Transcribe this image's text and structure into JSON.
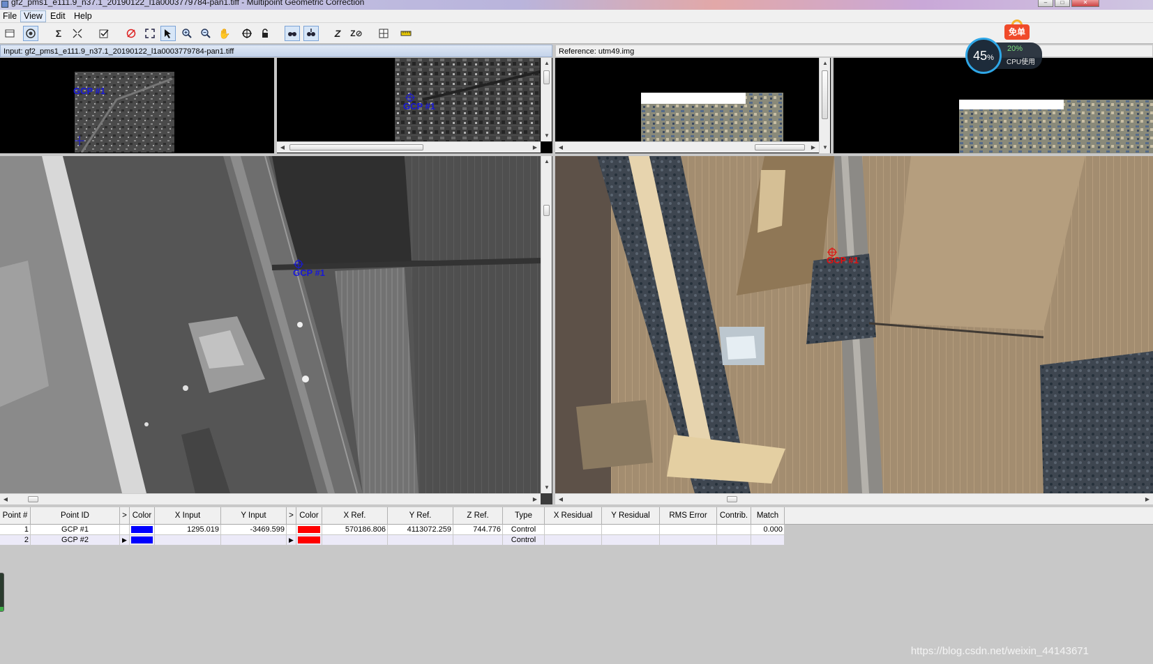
{
  "window": {
    "title": "gf2_pms1_e111.9_n37.1_20190122_l1a0003779784-pan1.tiff - Multipoint Geometric Correction"
  },
  "menu": [
    "File",
    "View",
    "Edit",
    "Help"
  ],
  "viewers": {
    "input_label": "Input: gf2_pms1_e111.9_n37.1_20190122_l1a0003779784-pan1.tiff",
    "reference_label": "Reference: utm49.img",
    "gcp_label": "GCP #1"
  },
  "gcp_table": {
    "columns": [
      "Point #",
      "Point ID",
      ">",
      "Color",
      "X Input",
      "Y Input",
      ">",
      "Color",
      "X Ref.",
      "Y Ref.",
      "Z Ref.",
      "Type",
      "X Residual",
      "Y Residual",
      "RMS Error",
      "Contrib.",
      "Match"
    ],
    "rows": [
      {
        "num": "1",
        "id": "GCP #1",
        "marker": "",
        "x_input": "1295.019",
        "y_input": "-3469.599",
        "marker2": "",
        "x_ref": "570186.806",
        "y_ref": "4113072.259",
        "z_ref": "744.776",
        "type": "Control",
        "x_res": "",
        "y_res": "",
        "rms": "",
        "contrib": "",
        "match": "0.000"
      },
      {
        "num": "2",
        "id": "GCP #2",
        "marker": "▶",
        "x_input": "",
        "y_input": "",
        "marker2": "▶",
        "x_ref": "",
        "y_ref": "",
        "z_ref": "",
        "type": "Control",
        "x_res": "",
        "y_res": "",
        "rms": "",
        "contrib": "",
        "match": ""
      }
    ],
    "input_color": "#0000ff",
    "ref_color": "#ff0000"
  },
  "cpu_widget": {
    "main_percent": "45",
    "percent_sign": "%",
    "cpu_percent": "20%",
    "cpu_label": "CPU使用"
  },
  "promo_label": "免单",
  "watermark": "https://blog.csdn.net/weixin_44143671",
  "colors": {
    "gcp_input": "#1818d8",
    "gcp_ref": "#e01010"
  }
}
